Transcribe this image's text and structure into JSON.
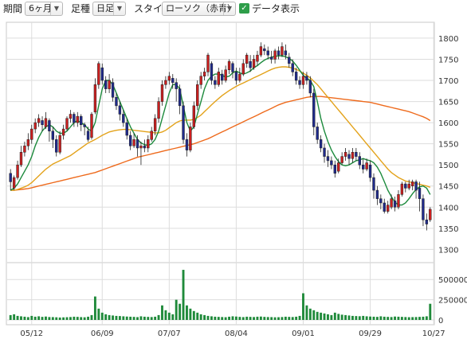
{
  "toolbar": {
    "period_label": "期間",
    "period_value": "6ヶ月",
    "ashi_label": "足種",
    "ashi_value": "日足",
    "style_label": "スタイル",
    "style_value": "ローソク（赤青）",
    "data_display_label": "データ表示",
    "data_display_checked": true
  },
  "colors": {
    "up_candle": "#cc1f1f",
    "down_candle": "#1f2a8c",
    "ma_short": "#1c8a3c",
    "ma_mid": "#e3a21a",
    "ma_long": "#ee6a1c",
    "volume_bar": "#1f8a3a",
    "grid": "#dddddd"
  },
  "chart_data": {
    "type": "candlestick",
    "price_axis": {
      "ticks": [
        1300,
        1350,
        1400,
        1450,
        1500,
        1550,
        1600,
        1650,
        1700,
        1750,
        1800
      ],
      "range": [
        1280,
        1830
      ]
    },
    "volume_axis": {
      "ticks": [
        0,
        250000,
        500000
      ],
      "labels": [
        "0",
        "250000",
        "500000"
      ],
      "range": [
        0,
        650000
      ]
    },
    "x_labels": [
      {
        "label": "05/12",
        "index": 6
      },
      {
        "label": "06/09",
        "index": 26
      },
      {
        "label": "07/07",
        "index": 45
      },
      {
        "label": "08/04",
        "index": 64
      },
      {
        "label": "09/01",
        "index": 83
      },
      {
        "label": "09/29",
        "index": 102
      },
      {
        "label": "10/27",
        "index": 120
      }
    ],
    "candles": [
      [
        1480,
        1460,
        1490,
        1440
      ],
      [
        1445,
        1470,
        1475,
        1440
      ],
      [
        1470,
        1500,
        1510,
        1465
      ],
      [
        1500,
        1530,
        1545,
        1495
      ],
      [
        1530,
        1545,
        1555,
        1520
      ],
      [
        1545,
        1560,
        1575,
        1535
      ],
      [
        1560,
        1585,
        1595,
        1550
      ],
      [
        1585,
        1600,
        1610,
        1575
      ],
      [
        1600,
        1610,
        1620,
        1590
      ],
      [
        1605,
        1595,
        1615,
        1580
      ],
      [
        1590,
        1610,
        1625,
        1585
      ],
      [
        1605,
        1580,
        1610,
        1555
      ],
      [
        1580,
        1560,
        1590,
        1540
      ],
      [
        1560,
        1530,
        1570,
        1520
      ],
      [
        1530,
        1570,
        1580,
        1525
      ],
      [
        1570,
        1585,
        1595,
        1560
      ],
      [
        1585,
        1610,
        1615,
        1580
      ],
      [
        1610,
        1620,
        1630,
        1600
      ],
      [
        1620,
        1600,
        1625,
        1590
      ],
      [
        1600,
        1615,
        1625,
        1590
      ],
      [
        1615,
        1595,
        1620,
        1580
      ],
      [
        1595,
        1590,
        1600,
        1570
      ],
      [
        1580,
        1560,
        1590,
        1555
      ],
      [
        1565,
        1620,
        1625,
        1560
      ],
      [
        1625,
        1690,
        1705,
        1620
      ],
      [
        1690,
        1740,
        1745,
        1680
      ],
      [
        1730,
        1700,
        1740,
        1690
      ],
      [
        1700,
        1680,
        1710,
        1670
      ],
      [
        1680,
        1700,
        1715,
        1670
      ],
      [
        1695,
        1660,
        1705,
        1650
      ],
      [
        1660,
        1640,
        1670,
        1630
      ],
      [
        1640,
        1620,
        1650,
        1605
      ],
      [
        1620,
        1600,
        1630,
        1590
      ],
      [
        1600,
        1570,
        1610,
        1560
      ],
      [
        1570,
        1545,
        1580,
        1535
      ],
      [
        1545,
        1560,
        1575,
        1540
      ],
      [
        1560,
        1540,
        1570,
        1520
      ],
      [
        1540,
        1545,
        1555,
        1500
      ],
      [
        1545,
        1540,
        1560,
        1530
      ],
      [
        1540,
        1560,
        1570,
        1530
      ],
      [
        1560,
        1580,
        1590,
        1555
      ],
      [
        1580,
        1610,
        1620,
        1570
      ],
      [
        1610,
        1650,
        1660,
        1600
      ],
      [
        1650,
        1690,
        1700,
        1640
      ],
      [
        1690,
        1700,
        1710,
        1680
      ],
      [
        1700,
        1710,
        1720,
        1690
      ],
      [
        1705,
        1695,
        1715,
        1680
      ],
      [
        1695,
        1680,
        1705,
        1650
      ],
      [
        1680,
        1640,
        1690,
        1620
      ],
      [
        1640,
        1560,
        1650,
        1550
      ],
      [
        1560,
        1535,
        1575,
        1520
      ],
      [
        1535,
        1590,
        1600,
        1530
      ],
      [
        1590,
        1640,
        1650,
        1585
      ],
      [
        1640,
        1690,
        1700,
        1630
      ],
      [
        1690,
        1710,
        1720,
        1680
      ],
      [
        1710,
        1720,
        1730,
        1700
      ],
      [
        1720,
        1760,
        1765,
        1710
      ],
      [
        1740,
        1700,
        1745,
        1690
      ],
      [
        1700,
        1690,
        1710,
        1680
      ],
      [
        1690,
        1720,
        1730,
        1685
      ],
      [
        1715,
        1700,
        1725,
        1690
      ],
      [
        1700,
        1725,
        1735,
        1695
      ],
      [
        1725,
        1745,
        1750,
        1715
      ],
      [
        1740,
        1720,
        1745,
        1705
      ],
      [
        1720,
        1700,
        1730,
        1690
      ],
      [
        1700,
        1715,
        1730,
        1695
      ],
      [
        1715,
        1740,
        1750,
        1710
      ],
      [
        1740,
        1760,
        1765,
        1730
      ],
      [
        1745,
        1730,
        1760,
        1720
      ],
      [
        1730,
        1750,
        1760,
        1725
      ],
      [
        1745,
        1760,
        1770,
        1735
      ],
      [
        1760,
        1780,
        1790,
        1755
      ],
      [
        1775,
        1770,
        1785,
        1760
      ],
      [
        1770,
        1760,
        1780,
        1750
      ],
      [
        1755,
        1750,
        1770,
        1740
      ],
      [
        1750,
        1770,
        1775,
        1740
      ],
      [
        1770,
        1760,
        1780,
        1750
      ],
      [
        1760,
        1780,
        1790,
        1755
      ],
      [
        1770,
        1760,
        1785,
        1750
      ],
      [
        1755,
        1740,
        1765,
        1730
      ],
      [
        1740,
        1720,
        1750,
        1710
      ],
      [
        1720,
        1700,
        1730,
        1690
      ],
      [
        1700,
        1690,
        1710,
        1680
      ],
      [
        1690,
        1710,
        1720,
        1680
      ],
      [
        1710,
        1700,
        1720,
        1690
      ],
      [
        1700,
        1670,
        1710,
        1660
      ],
      [
        1670,
        1590,
        1680,
        1570
      ],
      [
        1590,
        1560,
        1600,
        1550
      ],
      [
        1560,
        1540,
        1570,
        1530
      ],
      [
        1540,
        1520,
        1550,
        1505
      ],
      [
        1520,
        1510,
        1535,
        1495
      ],
      [
        1510,
        1500,
        1520,
        1490
      ],
      [
        1500,
        1480,
        1510,
        1470
      ],
      [
        1485,
        1505,
        1515,
        1480
      ],
      [
        1505,
        1520,
        1530,
        1500
      ],
      [
        1520,
        1530,
        1540,
        1510
      ],
      [
        1525,
        1515,
        1535,
        1500
      ],
      [
        1515,
        1530,
        1540,
        1505
      ],
      [
        1530,
        1520,
        1540,
        1510
      ],
      [
        1520,
        1500,
        1530,
        1490
      ],
      [
        1500,
        1490,
        1515,
        1480
      ],
      [
        1490,
        1505,
        1515,
        1485
      ],
      [
        1500,
        1470,
        1510,
        1460
      ],
      [
        1470,
        1440,
        1480,
        1420
      ],
      [
        1440,
        1420,
        1450,
        1405
      ],
      [
        1420,
        1410,
        1430,
        1395
      ],
      [
        1410,
        1390,
        1420,
        1385
      ],
      [
        1390,
        1405,
        1415,
        1385
      ],
      [
        1400,
        1420,
        1430,
        1395
      ],
      [
        1415,
        1400,
        1425,
        1390
      ],
      [
        1400,
        1430,
        1440,
        1395
      ],
      [
        1430,
        1455,
        1460,
        1425
      ],
      [
        1455,
        1445,
        1460,
        1435
      ],
      [
        1445,
        1455,
        1465,
        1440
      ],
      [
        1450,
        1460,
        1465,
        1440
      ],
      [
        1460,
        1440,
        1465,
        1420
      ],
      [
        1445,
        1420,
        1460,
        1390
      ],
      [
        1420,
        1370,
        1430,
        1355
      ],
      [
        1370,
        1360,
        1385,
        1345
      ],
      [
        1370,
        1395,
        1400,
        1365
      ]
    ],
    "ma_short": [
      1440,
      1445,
      1455,
      1470,
      1485,
      1500,
      1520,
      1545,
      1565,
      1580,
      1590,
      1595,
      1590,
      1580,
      1575,
      1575,
      1580,
      1590,
      1600,
      1605,
      1600,
      1595,
      1585,
      1580,
      1600,
      1640,
      1680,
      1700,
      1700,
      1690,
      1670,
      1650,
      1630,
      1610,
      1590,
      1575,
      1560,
      1552,
      1548,
      1546,
      1550,
      1560,
      1580,
      1610,
      1640,
      1670,
      1690,
      1690,
      1680,
      1640,
      1600,
      1580,
      1590,
      1620,
      1650,
      1680,
      1700,
      1710,
      1715,
      1715,
      1712,
      1708,
      1710,
      1718,
      1722,
      1718,
      1715,
      1718,
      1722,
      1730,
      1735,
      1742,
      1748,
      1752,
      1755,
      1757,
      1758,
      1758,
      1756,
      1752,
      1746,
      1736,
      1724,
      1712,
      1705,
      1700,
      1685,
      1650,
      1610,
      1580,
      1555,
      1535,
      1520,
      1508,
      1500,
      1498,
      1500,
      1505,
      1510,
      1512,
      1515,
      1512,
      1510,
      1505,
      1495,
      1480,
      1460,
      1440,
      1425,
      1412,
      1405,
      1405,
      1410,
      1420,
      1432,
      1442,
      1448,
      1450,
      1445,
      1430,
      1410,
      1395
    ],
    "ma_mid": [
      1440,
      1440,
      1442,
      1445,
      1448,
      1452,
      1458,
      1466,
      1474,
      1482,
      1490,
      1496,
      1502,
      1506,
      1510,
      1514,
      1518,
      1522,
      1528,
      1534,
      1540,
      1546,
      1552,
      1556,
      1560,
      1565,
      1570,
      1574,
      1578,
      1580,
      1582,
      1583,
      1584,
      1584,
      1583,
      1582,
      1581,
      1580,
      1579,
      1578,
      1577,
      1576,
      1576,
      1578,
      1582,
      1588,
      1594,
      1600,
      1604,
      1606,
      1606,
      1606,
      1608,
      1612,
      1618,
      1626,
      1634,
      1642,
      1650,
      1657,
      1664,
      1670,
      1676,
      1681,
      1686,
      1690,
      1694,
      1698,
      1702,
      1706,
      1710,
      1714,
      1718,
      1722,
      1726,
      1729,
      1731,
      1732,
      1732,
      1731,
      1729,
      1726,
      1722,
      1717,
      1712,
      1706,
      1698,
      1690,
      1680,
      1670,
      1660,
      1650,
      1640,
      1630,
      1620,
      1610,
      1600,
      1590,
      1580,
      1570,
      1560,
      1550,
      1540,
      1530,
      1520,
      1510,
      1500,
      1490,
      1482,
      1476,
      1470,
      1466,
      1462,
      1460,
      1458,
      1456,
      1454,
      1452,
      1450,
      1447,
      1444,
      1440
    ],
    "ma_long": [
      1440,
      1440,
      1441,
      1442,
      1443,
      1444,
      1446,
      1448,
      1450,
      1452,
      1454,
      1456,
      1458,
      1460,
      1462,
      1464,
      1466,
      1468,
      1470,
      1472,
      1474,
      1476,
      1478,
      1480,
      1482,
      1485,
      1488,
      1491,
      1494,
      1497,
      1500,
      1503,
      1506,
      1509,
      1512,
      1515,
      1518,
      1520,
      1522,
      1524,
      1526,
      1528,
      1530,
      1532,
      1534,
      1536,
      1538,
      1540,
      1542,
      1544,
      1546,
      1548,
      1550,
      1553,
      1556,
      1559,
      1562,
      1566,
      1570,
      1574,
      1578,
      1582,
      1586,
      1590,
      1594,
      1598,
      1602,
      1606,
      1610,
      1614,
      1618,
      1622,
      1626,
      1630,
      1634,
      1638,
      1642,
      1645,
      1648,
      1650,
      1652,
      1654,
      1656,
      1658,
      1660,
      1661,
      1662,
      1662,
      1662,
      1661,
      1660,
      1659,
      1658,
      1657,
      1656,
      1655,
      1654,
      1653,
      1652,
      1651,
      1650,
      1649,
      1648,
      1646,
      1644,
      1642,
      1640,
      1638,
      1636,
      1634,
      1632,
      1630,
      1628,
      1626,
      1623,
      1620,
      1617,
      1614,
      1610,
      1605,
      1600,
      1592
    ],
    "volume": [
      60000,
      70000,
      50000,
      45000,
      40000,
      35000,
      50000,
      40000,
      45000,
      38000,
      42000,
      36000,
      35000,
      33000,
      30000,
      32000,
      34000,
      36000,
      40000,
      38000,
      35000,
      33000,
      40000,
      60000,
      290000,
      140000,
      90000,
      70000,
      60000,
      55000,
      50000,
      48000,
      45000,
      42000,
      40000,
      38000,
      35000,
      45000,
      40000,
      38000,
      36000,
      40000,
      60000,
      180000,
      120000,
      90000,
      70000,
      250000,
      200000,
      620000,
      180000,
      140000,
      110000,
      90000,
      70000,
      60000,
      50000,
      45000,
      40000,
      38000,
      36000,
      34000,
      40000,
      45000,
      42000,
      38000,
      35000,
      40000,
      38000,
      36000,
      40000,
      42000,
      38000,
      36000,
      35000,
      33000,
      34000,
      36000,
      40000,
      38000,
      36000,
      40000,
      50000,
      330000,
      180000,
      140000,
      120000,
      100000,
      90000,
      80000,
      70000,
      60000,
      90000,
      75000,
      65000,
      60000,
      55000,
      50000,
      48000,
      46000,
      50000,
      45000,
      42000,
      40000,
      38000,
      45000,
      40000,
      38000,
      36000,
      42000,
      40000,
      38000,
      36000,
      34000,
      35000,
      36000,
      38000,
      40000,
      45000,
      200000,
      90000,
      50000
    ]
  }
}
